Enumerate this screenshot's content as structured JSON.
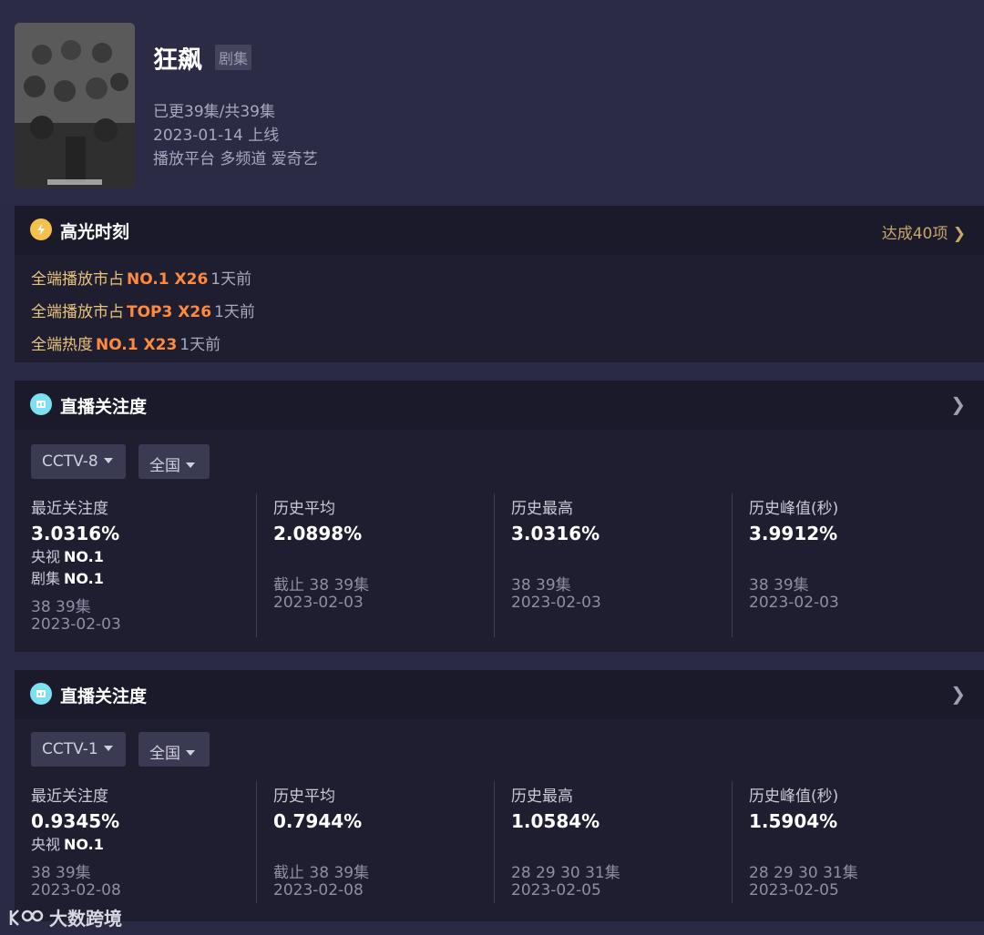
{
  "show": {
    "title": "狂飙",
    "tag": "剧集",
    "episodes": "已更39集/共39集",
    "release": "2023-01-14 上线",
    "platforms": "播放平台 多频道 爱奇艺"
  },
  "highlights": {
    "title": "高光时刻",
    "link": "达成40项",
    "rows": [
      {
        "label": "全端播放市占",
        "rank": "NO.1 X26",
        "ago": "1天前"
      },
      {
        "label": "全端播放市占",
        "rank": "TOP3 X26",
        "ago": "1天前"
      },
      {
        "label": "全端热度",
        "rank": "NO.1 X23",
        "ago": "1天前"
      }
    ]
  },
  "live1": {
    "title": "直播关注度",
    "channel": "CCTV-8",
    "region": "全国",
    "recent": {
      "label": "最近关注度",
      "value": "3.0316%",
      "rank1_label": "央视",
      "rank1": "NO.1",
      "rank2_label": "剧集",
      "rank2": "NO.1",
      "episode": "38 39集",
      "date": "2023-02-03"
    },
    "average": {
      "label": "历史平均",
      "value": "2.0898%",
      "episode": "截止 38 39集",
      "date": "2023-02-03"
    },
    "highest": {
      "label": "历史最高",
      "value": "3.0316%",
      "episode": "38 39集",
      "date": "2023-02-03"
    },
    "peak": {
      "label": "历史峰值(秒)",
      "value": "3.9912%",
      "episode": "38 39集",
      "date": "2023-02-03"
    }
  },
  "live2": {
    "title": "直播关注度",
    "channel": "CCTV-1",
    "region": "全国",
    "recent": {
      "label": "最近关注度",
      "value": "0.9345%",
      "rank1_label": "央视",
      "rank1": "NO.1",
      "episode": "38 39集",
      "date": "2023-02-08"
    },
    "average": {
      "label": "历史平均",
      "value": "0.7944%",
      "episode": "截止 38 39集",
      "date": "2023-02-08"
    },
    "highest": {
      "label": "历史最高",
      "value": "1.0584%",
      "episode": "28 29 30 31集",
      "date": "2023-02-05"
    },
    "peak": {
      "label": "历史峰值(秒)",
      "value": "1.5904%",
      "episode": "28 29 30 31集",
      "date": "2023-02-05"
    }
  },
  "watermark": "大数跨境",
  "colors": {
    "accent_orange": "#ff8a3d",
    "gold": "#e8c47a",
    "link": "#c9a56a",
    "bg": "#2a2a44",
    "panel": "#1e1e30"
  }
}
